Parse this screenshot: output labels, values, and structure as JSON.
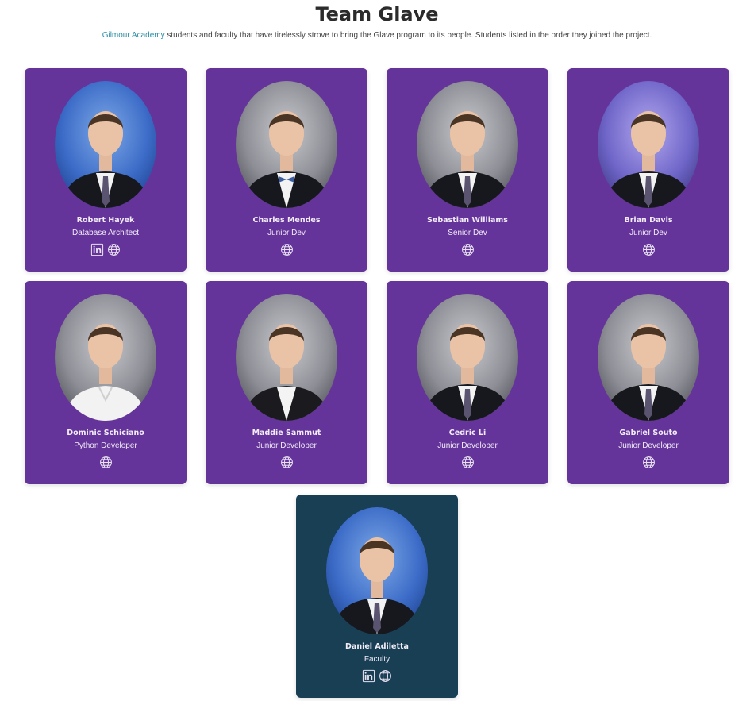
{
  "header": {
    "title": "Team Glave",
    "subtitle_link": "Gilmour Academy",
    "subtitle_text": " students and faculty that have tirelessly strove to bring the Glave program to its people. Students listed in the order they joined the project."
  },
  "colors": {
    "student_card": "#65349a",
    "faculty_card": "#193f55",
    "link": "#2a8fa6"
  },
  "members": [
    {
      "name": "Robert Hayek",
      "role": "Database Architect",
      "icons": [
        "linkedin-icon",
        "globe-icon"
      ]
    },
    {
      "name": "Charles Mendes",
      "role": "Junior Dev",
      "icons": [
        "globe-icon"
      ]
    },
    {
      "name": "Sebastian Williams",
      "role": "Senior Dev",
      "icons": [
        "globe-icon"
      ]
    },
    {
      "name": "Brian Davis",
      "role": "Junior Dev",
      "icons": [
        "globe-icon"
      ]
    },
    {
      "name": "Dominic Schiciano",
      "role": "Python Developer",
      "icons": [
        "globe-icon"
      ]
    },
    {
      "name": "Maddie Sammut",
      "role": "Junior Developer",
      "icons": [
        "globe-icon"
      ]
    },
    {
      "name": "Cedric Li",
      "role": "Junior Developer",
      "icons": [
        "globe-icon"
      ]
    },
    {
      "name": "Gabriel Souto",
      "role": "Junior Developer",
      "icons": [
        "globe-icon"
      ]
    },
    {
      "name": "Daniel Adiletta",
      "role": "Faculty",
      "icons": [
        "linkedin-icon",
        "globe-icon"
      ]
    }
  ]
}
